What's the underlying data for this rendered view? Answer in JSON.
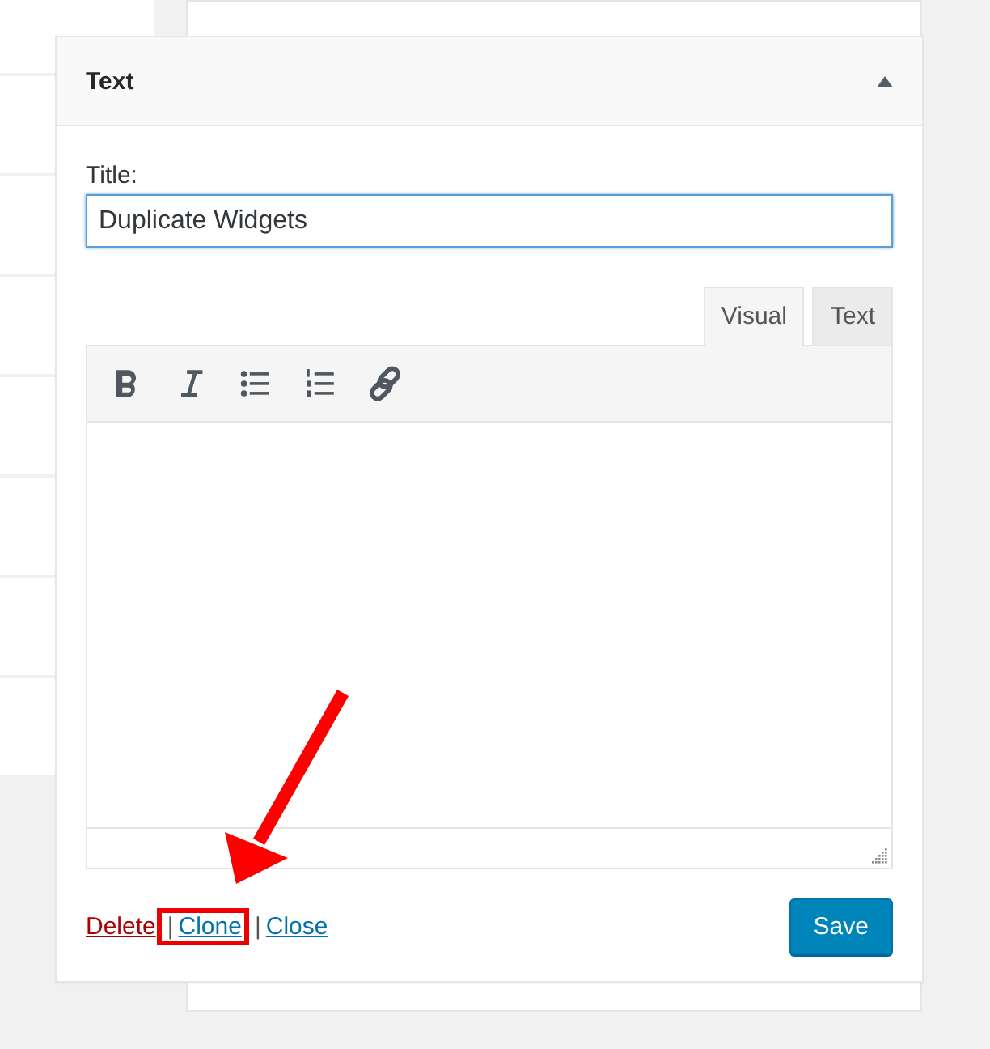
{
  "widget": {
    "title": "Text",
    "expanded": true,
    "title_field": {
      "label": "Title:",
      "value": "Duplicate Widgets"
    },
    "editor_tabs": [
      {
        "label": "Visual",
        "selected": true
      },
      {
        "label": "Text",
        "selected": false
      }
    ],
    "toolbar": [
      {
        "kind": "bold"
      },
      {
        "kind": "italic"
      },
      {
        "kind": "bullet-list"
      },
      {
        "kind": "numbered-list"
      },
      {
        "kind": "link"
      }
    ],
    "footer_links": [
      {
        "label": "Delete",
        "kind": "danger",
        "highlighted": false
      },
      {
        "label": "|",
        "kind": "separator",
        "highlighted": true
      },
      {
        "label": "Clone",
        "kind": "link",
        "highlighted": true
      },
      {
        "label": "|",
        "kind": "separator",
        "highlighted": false
      },
      {
        "label": "Close",
        "kind": "link",
        "highlighted": false
      }
    ],
    "save_button": "Save"
  }
}
